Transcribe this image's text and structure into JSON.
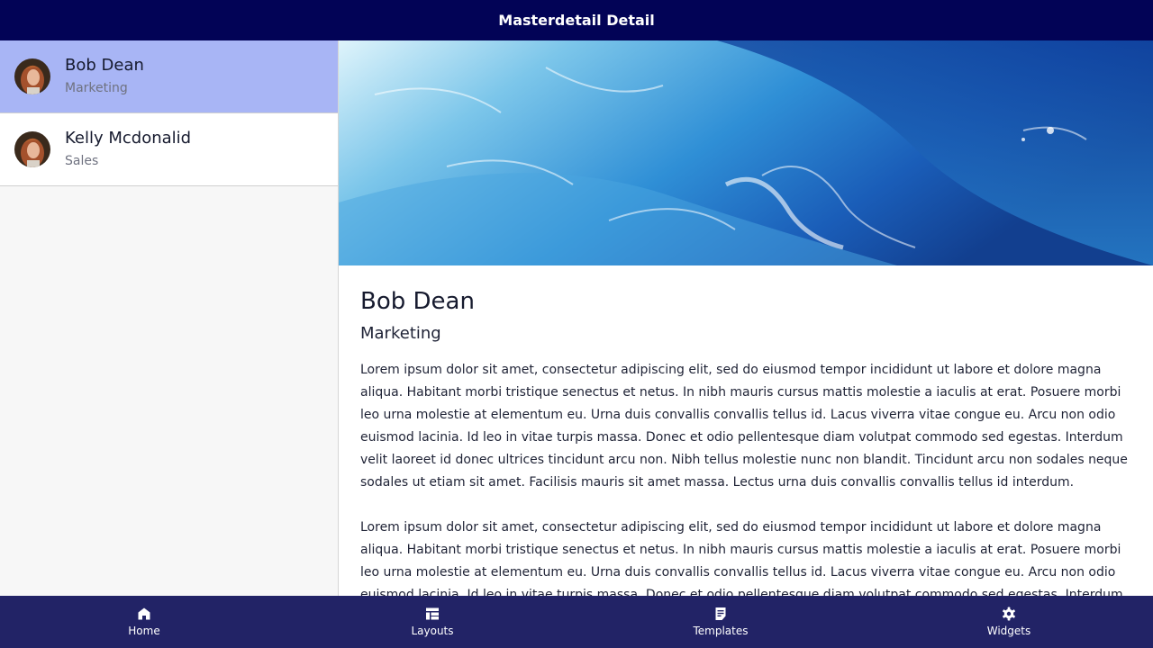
{
  "header": {
    "title": "Masterdetail Detail"
  },
  "list": [
    {
      "name": "Bob Dean",
      "department": "Marketing",
      "selected": true
    },
    {
      "name": "Kelly Mcdonalid",
      "department": "Sales",
      "selected": false
    }
  ],
  "detail": {
    "name": "Bob Dean",
    "department": "Marketing",
    "paragraphs": [
      "Lorem ipsum dolor sit amet, consectetur adipiscing elit, sed do eiusmod tempor incididunt ut labore et dolore magna aliqua. Habitant morbi tristique senectus et netus. In nibh mauris cursus mattis molestie a iaculis at erat. Posuere morbi leo urna molestie at elementum eu. Urna duis convallis convallis tellus id. Lacus viverra vitae congue eu. Arcu non odio euismod lacinia. Id leo in vitae turpis massa. Donec et odio pellentesque diam volutpat commodo sed egestas. Interdum velit laoreet id donec ultrices tincidunt arcu non. Nibh tellus molestie nunc non blandit. Tincidunt arcu non sodales neque sodales ut etiam sit amet. Facilisis mauris sit amet massa. Lectus urna duis convallis convallis tellus id interdum.",
      "Lorem ipsum dolor sit amet, consectetur adipiscing elit, sed do eiusmod tempor incididunt ut labore et dolore magna aliqua. Habitant morbi tristique senectus et netus. In nibh mauris cursus mattis molestie a iaculis at erat. Posuere morbi leo urna molestie at elementum eu. Urna duis convallis convallis tellus id. Lacus viverra vitae congue eu. Arcu non odio euismod lacinia. Id leo in vitae turpis massa. Donec et odio pellentesque diam volutpat commodo sed egestas. Interdum velit laoreet id donec"
    ]
  },
  "bottom_nav": [
    {
      "label": "Home",
      "icon": "home-icon"
    },
    {
      "label": "Layouts",
      "icon": "layouts-icon"
    },
    {
      "label": "Templates",
      "icon": "templates-icon"
    },
    {
      "label": "Widgets",
      "icon": "gear-icon"
    }
  ],
  "colors": {
    "topbar": "#020356",
    "bottombar": "#222366",
    "selected_item": "#a8b5f5"
  }
}
